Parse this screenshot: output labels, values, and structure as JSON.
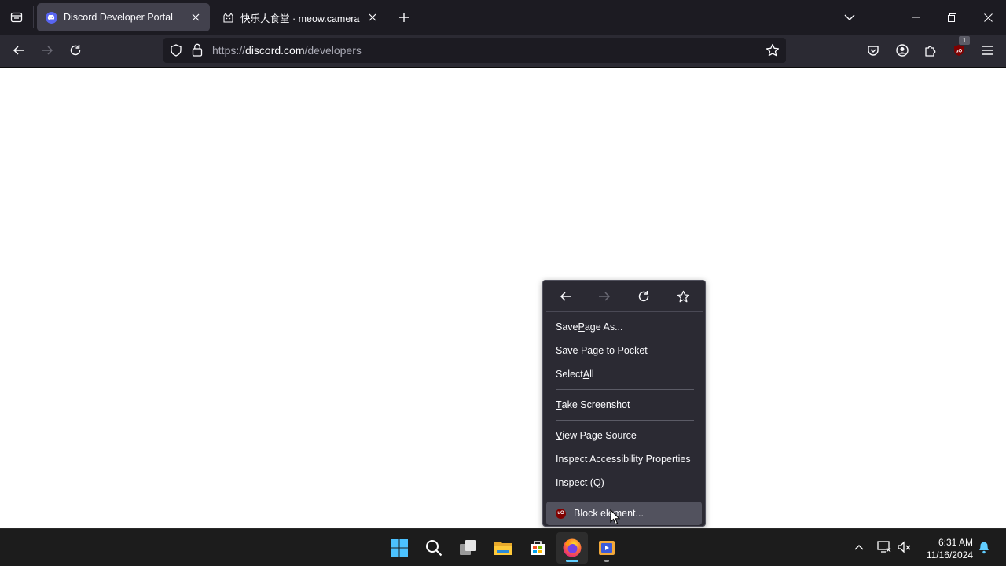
{
  "browser": {
    "tabs": [
      {
        "title": "Discord Developer Portal",
        "favicon": "discord-logo",
        "active": true
      },
      {
        "title": "快乐大食堂 · meow.camera",
        "favicon": "cat-icon",
        "active": false
      }
    ],
    "url": {
      "scheme": "https://",
      "host": "discord.com",
      "path": "/developers"
    },
    "extensions_badge": "1"
  },
  "context_menu": {
    "nav_icons": [
      "back-arrow-icon",
      "forward-arrow-icon",
      "reload-icon",
      "bookmark-star-icon"
    ],
    "items": [
      {
        "pre": "Save ",
        "key": "P",
        "post": "age As..."
      },
      {
        "pre": "Save Page to Poc",
        "key": "k",
        "post": "et"
      },
      {
        "pre": "Select ",
        "key": "A",
        "post": "ll"
      },
      {
        "pre": "",
        "key": "T",
        "post": "ake Screenshot"
      },
      {
        "pre": "",
        "key": "V",
        "post": "iew Page Source"
      },
      {
        "pre": "Inspect Accessibility Properties",
        "key": "",
        "post": ""
      },
      {
        "pre": "Inspect (",
        "key": "Q",
        "post": ")"
      },
      {
        "pre": "Block element...",
        "key": "",
        "post": "",
        "icon_text": "uO"
      }
    ]
  },
  "taskbar": {
    "apps": [
      "windows-start",
      "search",
      "task-view",
      "file-explorer",
      "microsoft-store",
      "firefox",
      "media-player"
    ],
    "time": "6:31 AM",
    "date": "11/16/2024"
  },
  "colors": {
    "tabstrip": "#1c1b22",
    "navbar": "#2b2a33",
    "menu_bg": "#2b2a33",
    "menu_hover": "#52525e",
    "discord": "#5865f2",
    "ublock": "#800000",
    "taskbar": "#1c1c1c",
    "taskbar_accent": "#60cdff"
  }
}
